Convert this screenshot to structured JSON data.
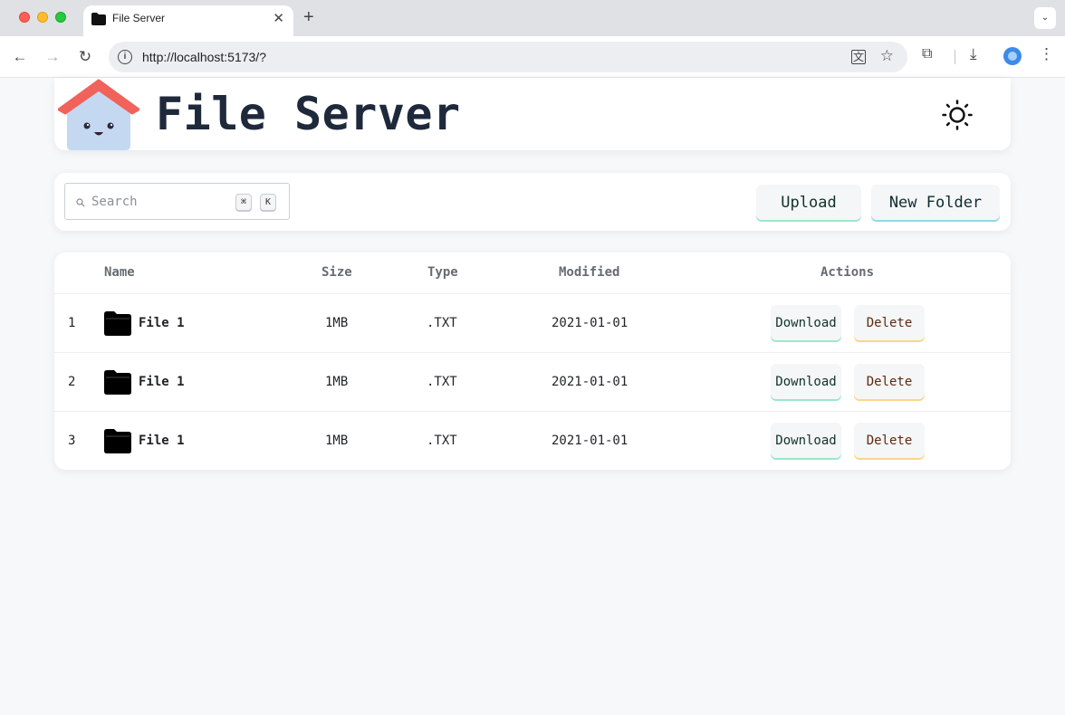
{
  "browser": {
    "tab_title": "File Server",
    "tab_close": "✕",
    "new_tab": "+",
    "tab_menu": "⌄",
    "url": "http://localhost:5173/?",
    "info": "i",
    "translate": "文",
    "star": "☆",
    "extensions": "⧉",
    "download": "⤓",
    "menu": "⋮",
    "back": "←",
    "forward": "→",
    "reload": "↻"
  },
  "app": {
    "title": "File Server",
    "logo_icon": "house-mascot-logo",
    "theme_icon": "sun-icon"
  },
  "toolbar": {
    "search_placeholder": "Search",
    "shortcut_cmd": "⌘",
    "shortcut_key": "K",
    "upload_label": "Upload",
    "new_folder_label": "New Folder"
  },
  "table": {
    "headers": {
      "name": "Name",
      "size": "Size",
      "type": "Type",
      "modified": "Modified",
      "actions": "Actions"
    },
    "rows": [
      {
        "index": "1",
        "name": "File 1",
        "size": "1MB",
        "type": ".TXT",
        "modified": "2021-01-01",
        "download": "Download",
        "delete": "Delete"
      },
      {
        "index": "2",
        "name": "File 1",
        "size": "1MB",
        "type": ".TXT",
        "modified": "2021-01-01",
        "download": "Download",
        "delete": "Delete"
      },
      {
        "index": "3",
        "name": "File 1",
        "size": "1MB",
        "type": ".TXT",
        "modified": "2021-01-01",
        "download": "Download",
        "delete": "Delete"
      }
    ]
  },
  "colors": {
    "accent_green": "#9be8c9",
    "accent_cyan": "#8fd9ea",
    "accent_amber": "#fbd58a",
    "title_color": "#1e293b",
    "logo_roof": "#f0625a",
    "logo_body": "#c5d8f2"
  }
}
